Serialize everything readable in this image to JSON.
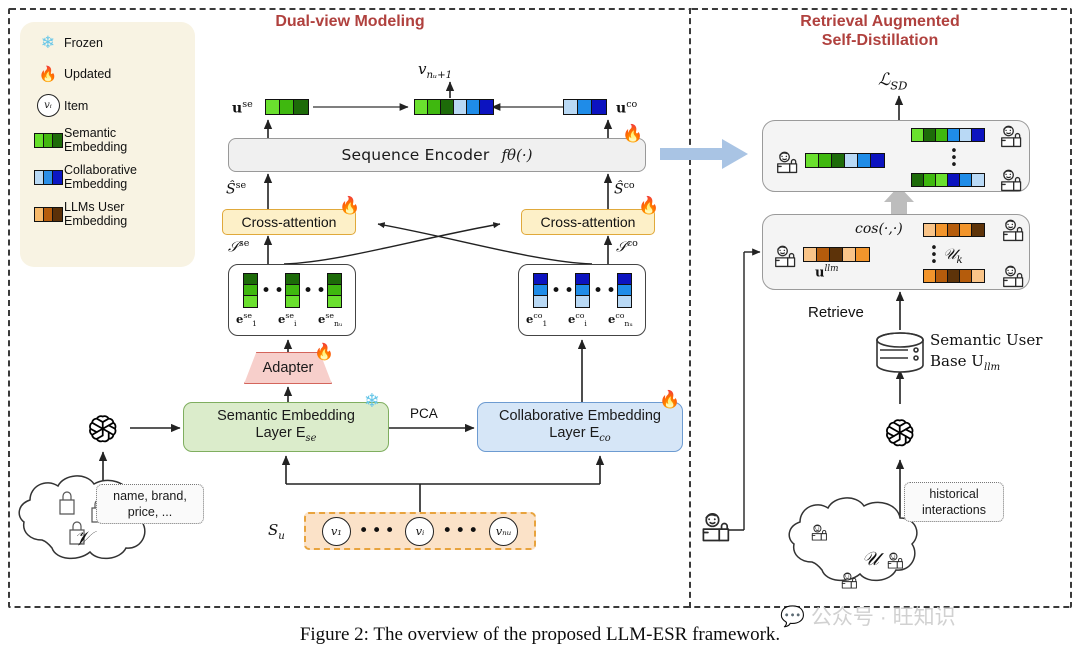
{
  "figure": {
    "caption": "Figure 2: The overview of the proposed LLM-ESR framework.",
    "watermark": "公众号 · 旺知识",
    "watermark_icon": "wechat-bubble-icon"
  },
  "panels": {
    "left_title": "Dual-view Modeling",
    "right_title": "Retrieval Augmented\nSelf-Distillation",
    "right_title_line1": "Retrieval Augmented",
    "right_title_line2": "Self-Distillation",
    "title_color": "#b0413e"
  },
  "legend": {
    "items": [
      {
        "icon": "snowflake-icon",
        "label": "Frozen",
        "swatch": null
      },
      {
        "icon": "flame-icon",
        "label": "Updated",
        "swatch": null
      },
      {
        "icon": "item-circle-icon",
        "label": "Item",
        "glyph": "vᵢ",
        "swatch": null
      },
      {
        "icon": "green-strip-icon",
        "label": "Semantic\nEmbedding",
        "label_line1": "Semantic",
        "label_line2": "Embedding",
        "swatch": [
          "#66e02a",
          "#44b811",
          "#1e6b0a"
        ]
      },
      {
        "icon": "blue-strip-icon",
        "label": "Collaborative\nEmbedding",
        "label_line1": "Collaborative",
        "label_line2": "Embedding",
        "swatch": [
          "#b9d9f5",
          "#2b8fe8",
          "#0c17c4"
        ]
      },
      {
        "icon": "orange-strip-icon",
        "label": "LLMs User\nEmbedding",
        "label_line1": "LLMs User",
        "label_line2": "Embedding",
        "swatch": [
          "#f7b96a",
          "#b55c0c",
          "#5b3008"
        ]
      }
    ]
  },
  "colors": {
    "semantic_light": "#6ae02e",
    "semantic_mid": "#3fb80f",
    "semantic_dark": "#1d6b09",
    "collab_light": "#b9d9f5",
    "collab_mid": "#1f8ce8",
    "collab_dark": "#0c13c0",
    "llm_light": "#f9c488",
    "llm_mid": "#b55c0c",
    "llm_dark": "#5d3309",
    "llm_orange": "#f2952c",
    "transition_arrow": "#a9c4e4",
    "pink_arrow": "#ff85c2",
    "gray_arrow": "#bdbdbd",
    "semantic_layer_bg": "#dbeccb",
    "collab_layer_bg": "#d6e6f7",
    "adapter_bg": "#f7cfcb",
    "xattn_bg": "#fdf0c8",
    "sequence_bg": "#fbe2c8",
    "legend_bg": "#f8f3e3"
  },
  "left_panel": {
    "sequence_encoder": "Sequence Encoder",
    "sequence_encoder_fn": "fθ(·)",
    "cross_attention_left": "Cross-attention",
    "cross_attention_right": "Cross-attention",
    "adapter": "Adapter",
    "semantic_layer_line1": "Semantic Embedding",
    "semantic_layer_line2": "Layer  E",
    "semantic_layer_sub": "se",
    "collab_layer_line1": "Collaborative Embedding",
    "collab_layer_line2": "Layer  E",
    "collab_layer_sub": "co",
    "pca_label": "PCA",
    "attributes_line1": "name, brand,",
    "attributes_line2": "price, ...",
    "item_cloud_label": "𝒱",
    "sequence_label": "S",
    "sequence_label_sub": "u",
    "output_label": "v",
    "output_label_sub": "nᵤ+1",
    "u_se": "u",
    "u_se_sup": "se",
    "u_co": "u",
    "u_co_sup": "co",
    "s_hat_se": "Ŝ",
    "s_hat_se_sup": "se",
    "s_hat_co": "Ŝ",
    "s_hat_co_sup": "co",
    "s_se": "𝒮",
    "s_se_sup": "se",
    "s_co": "𝒮",
    "s_co_sup": "co",
    "emb_se_first": "e",
    "emb_se_first_sub": "1",
    "emb_se_i": "e",
    "emb_se_i_sub": "i",
    "emb_se_n": "e",
    "emb_se_n_sub": "nᵤ",
    "emb_se_sup": "se",
    "emb_co_sup": "co",
    "items": [
      "v₁",
      "vᵢ",
      "vₙᵤ"
    ],
    "u_se_vector": [
      "#6ae02e",
      "#3fb80f",
      "#1d6b09"
    ],
    "u_co_vector": [
      "#b9d9f5",
      "#1f8ce8",
      "#0c13c0"
    ],
    "fused_vector": [
      "#6ae02e",
      "#3fb80f",
      "#1d6b09",
      "#b9d9f5",
      "#1f8ce8",
      "#0c13c0"
    ],
    "emb_column_semantic": [
      "#1d6b09",
      "#3fb80f",
      "#6ae02e"
    ],
    "emb_column_collab": [
      "#0c13c0",
      "#1f8ce8",
      "#b9d9f5"
    ]
  },
  "right_panel": {
    "loss_label": "ℒ",
    "loss_sub": "SD",
    "cos_label": "cos(·,·)",
    "u_llm": "u",
    "u_llm_sup": "llm",
    "u_k": "𝒰",
    "u_k_sub": "k",
    "retrieve_label": "Retrieve",
    "semantic_base_line1": "Semantic User",
    "semantic_base_line2": "Base  U",
    "semantic_base_sub": "llm",
    "historical_line1": "historical",
    "historical_line2": "interactions",
    "user_cloud_label": "𝒰",
    "db_icon": "database-icon",
    "llm_icon": "openai-logo-icon",
    "user_icon": "shopper-person-icon",
    "u_llm_vector": [
      "#f9c488",
      "#b55c0c",
      "#5d3309",
      "#f9c488",
      "#f2952c"
    ],
    "uk_vector_top": [
      "#f9c488",
      "#f2952c",
      "#b55c0c",
      "#f2952c",
      "#5d3309"
    ],
    "uk_vector_bottom": [
      "#f2952c",
      "#b55c0c",
      "#5d3309",
      "#b55c0c",
      "#f9c488"
    ],
    "dist_vector_main": [
      "#6ae02e",
      "#3fb80f",
      "#1d6b09",
      "#b9d9f5",
      "#1f8ce8",
      "#0c13c0"
    ],
    "dist_vector_top": [
      "#6ae02e",
      "#1d6b09",
      "#3fb80f",
      "#1f8ce8",
      "#b9d9f5",
      "#0c13c0"
    ],
    "dist_vector_bottom": [
      "#1d6b09",
      "#3fb80f",
      "#6ae02e",
      "#0c13c0",
      "#1f8ce8",
      "#b9d9f5"
    ]
  }
}
